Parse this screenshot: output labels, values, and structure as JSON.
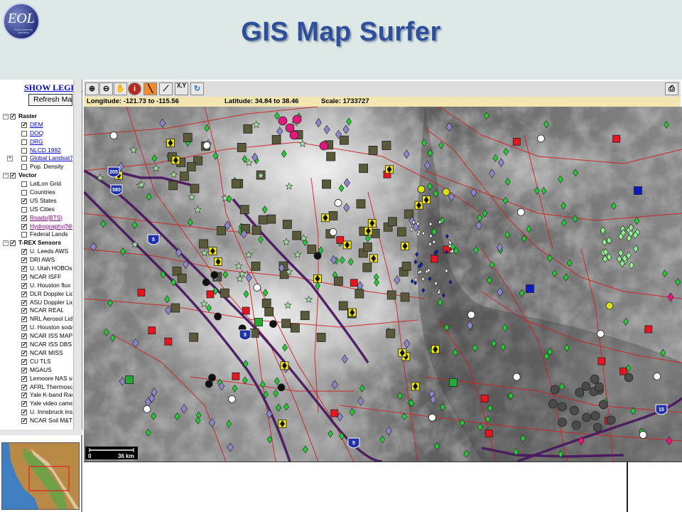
{
  "header": {
    "logo_text": "EOL",
    "logo_subtext": "Earth Observing Laboratory",
    "title": "GIS Map Surfer"
  },
  "left_panel": {
    "show_legend": "SHOW LEGEND",
    "refresh_button": "Refresh Map",
    "layers": [
      {
        "type": "group",
        "label": "Raster",
        "checked": true
      },
      {
        "type": "item",
        "label": "DEM",
        "checked": true,
        "style": "link"
      },
      {
        "type": "item",
        "label": "DOQ",
        "checked": false,
        "style": "link"
      },
      {
        "type": "item",
        "label": "DRG",
        "checked": false,
        "style": "link"
      },
      {
        "type": "item",
        "label": "NLCD 1992",
        "checked": false,
        "style": "link"
      },
      {
        "type": "item",
        "label": "Global Landsat7(",
        "checked": false,
        "style": "link",
        "expand": true
      },
      {
        "type": "item",
        "label": "Pop. Density",
        "checked": false
      },
      {
        "type": "group",
        "label": "Vector",
        "checked": true
      },
      {
        "type": "item",
        "label": "LatLon Grid",
        "checked": false
      },
      {
        "type": "item",
        "label": "Countries",
        "checked": false
      },
      {
        "type": "item",
        "label": "US States",
        "checked": true
      },
      {
        "type": "item",
        "label": "US Cities",
        "checked": false
      },
      {
        "type": "item",
        "label": "Roads(BTS)",
        "checked": true,
        "style": "link2"
      },
      {
        "type": "item",
        "label": "Hydrography(NH",
        "checked": true,
        "style": "link2"
      },
      {
        "type": "item",
        "label": "Federal Lands",
        "checked": false
      },
      {
        "type": "group",
        "label": "T-REX Sensors",
        "checked": true
      },
      {
        "type": "item",
        "label": "U. Leeds AWS",
        "checked": true
      },
      {
        "type": "item",
        "label": "DRI AWS",
        "checked": true
      },
      {
        "type": "item",
        "label": "U. Utah HOBOs",
        "checked": true
      },
      {
        "type": "item",
        "label": "NCAR ISFF",
        "checked": true
      },
      {
        "type": "item",
        "label": "U. Houston flux t",
        "checked": true
      },
      {
        "type": "item",
        "label": "DLR Doppler Lida",
        "checked": true
      },
      {
        "type": "item",
        "label": "ASU Doppler Lida",
        "checked": true
      },
      {
        "type": "item",
        "label": "NCAR REAL",
        "checked": true
      },
      {
        "type": "item",
        "label": "NRL Aerosol Lida",
        "checked": true
      },
      {
        "type": "item",
        "label": "U. Houston soda",
        "checked": true
      },
      {
        "type": "item",
        "label": "NCAR ISS MAPR",
        "checked": true
      },
      {
        "type": "item",
        "label": "NCAR ISS DBS",
        "checked": true
      },
      {
        "type": "item",
        "label": "NCAR MISS",
        "checked": true
      },
      {
        "type": "item",
        "label": "CU TLS",
        "checked": true
      },
      {
        "type": "item",
        "label": "MGAUS",
        "checked": true
      },
      {
        "type": "item",
        "label": "Lemoore NAS sc",
        "checked": true
      },
      {
        "type": "item",
        "label": "AFRL Thermosor",
        "checked": true
      },
      {
        "type": "item",
        "label": "Yale K-band Rad",
        "checked": true
      },
      {
        "type": "item",
        "label": "Yale video came",
        "checked": true
      },
      {
        "type": "item",
        "label": "U. Innsbruck inst",
        "checked": true
      },
      {
        "type": "item",
        "label": "NCAR Soil M&T",
        "checked": true
      }
    ]
  },
  "map": {
    "toolbar_icons": [
      "zoom-in-icon",
      "zoom-out-icon",
      "pan-hand-icon",
      "info-icon",
      "highlight-icon",
      "ruler-icon",
      "xy-coordinate-icon",
      "refresh-icon"
    ],
    "xy_label": "X,Y",
    "longitude": "Longitude: -121.73 to -115.56",
    "latitude": "Latitude: 34.84 to 38.46",
    "scale": "Scale: 1733727",
    "scalebar_left": "0",
    "scalebar_right": "36 km",
    "highway_labels": [
      "205",
      "580",
      "5",
      "5",
      "5",
      "15"
    ],
    "colors": {
      "roads": "#d21e1e",
      "highways": "#4a1860",
      "sensor_green": "#22cc33",
      "sensor_olive": "#5a5a3a",
      "sensor_blue": "#0a1cc8"
    }
  }
}
